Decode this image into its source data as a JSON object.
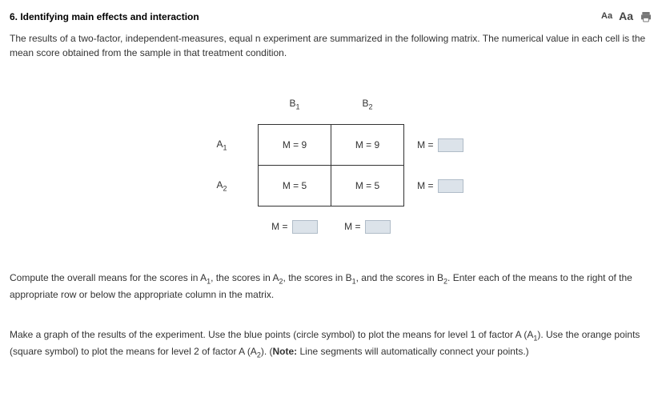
{
  "header": {
    "title": "6.  Identifying main effects and interaction"
  },
  "intro": {
    "p1a": "The results of a two-factor, independent-measures, equal n experiment are summarized in the following matrix. The numerical value in each cell is the mean score obtained from the sample in that treatment condition."
  },
  "matrix": {
    "col_headers": {
      "b1": "B",
      "b1s": "1",
      "b2": "B",
      "b2s": "2"
    },
    "row_headers": {
      "a1": "A",
      "a1s": "1",
      "a2": "A",
      "a2s": "2"
    },
    "cells": {
      "a1b1": "M = 9",
      "a1b2": "M = 9",
      "a2b1": "M = 5",
      "a2b2": "M = 5"
    },
    "marginal_label": "M ="
  },
  "paras": {
    "compute_a": "Compute the overall means for the scores in A",
    "compute_b": ", the scores in A",
    "compute_c": ", the scores in B",
    "compute_d": ", and the scores in B",
    "compute_e": ". Enter each of the means to the right of the appropriate row or below the appropriate column in the matrix.",
    "graph_a": "Make a graph of the results of the experiment. Use the blue points (circle symbol) to plot the means for level 1 of factor A (A",
    "graph_b": "). Use the orange points (square symbol) to plot the means for level 2 of factor A (A",
    "graph_c": "). (",
    "graph_note_label": "Note:",
    "graph_d": " Line segments will automatically connect your points.)",
    "sub1": "1",
    "sub2": "2"
  }
}
